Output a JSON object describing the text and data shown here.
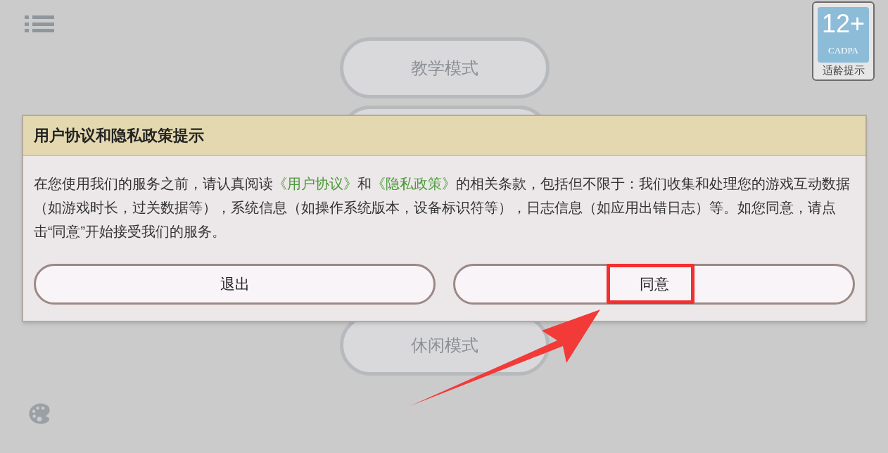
{
  "menu_buttons": [
    {
      "label": "教学模式"
    },
    {
      "label": "休闲模式"
    }
  ],
  "age_badge": {
    "rating": "12+",
    "org": "CADPA",
    "caption": "适龄提示"
  },
  "dialog": {
    "title": "用户协议和隐私政策提示",
    "message": [
      {
        "kind": "text",
        "text": "在您使用我们的服务之前，请认真阅读"
      },
      {
        "kind": "link",
        "text": "《用户协议》"
      },
      {
        "kind": "text",
        "text": "和"
      },
      {
        "kind": "link",
        "text": "《隐私政策》"
      },
      {
        "kind": "text",
        "text": "的相关条款，包括但不限于：我们收集和处理您的游戏互动数据（如游戏时长，过关数据等），系统信息（如操作系统版本，设备标识符等），日志信息（如应用出错日志）等。如您同意，请点击“同意”开始接受我们的服务。"
      }
    ],
    "buttons": [
      {
        "label": "退出",
        "highlighted": false
      },
      {
        "label": "同意",
        "highlighted": true
      }
    ]
  }
}
